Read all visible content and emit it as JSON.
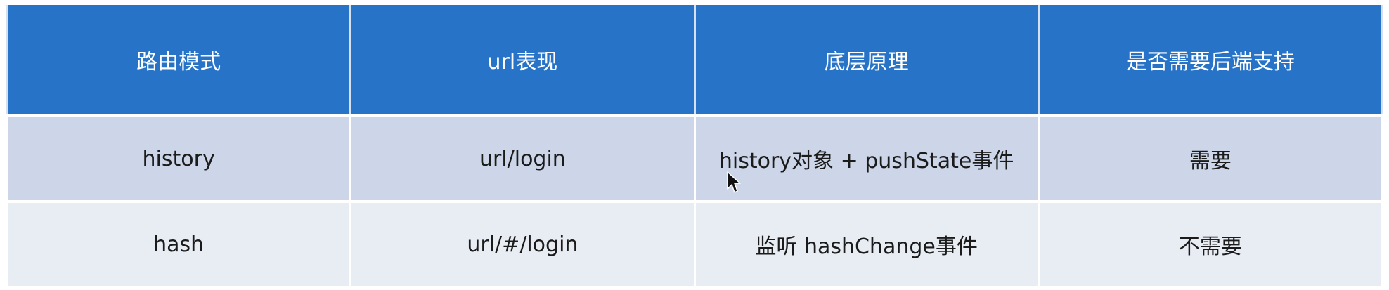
{
  "table": {
    "headers": [
      "路由模式",
      "url表现",
      "底层原理",
      "是否需要后端支持"
    ],
    "rows": [
      [
        "history",
        "url/login",
        "history对象 + pushState事件",
        "需要"
      ],
      [
        "hash",
        "url/#/login",
        "监听 hashChange事件",
        "不需要"
      ]
    ]
  },
  "colors": {
    "header_bg": "#2773c7",
    "row1_bg": "#ccd6e8",
    "row2_bg": "#e8ecf3"
  },
  "icons": {
    "cursor": "mouse-pointer-icon"
  }
}
